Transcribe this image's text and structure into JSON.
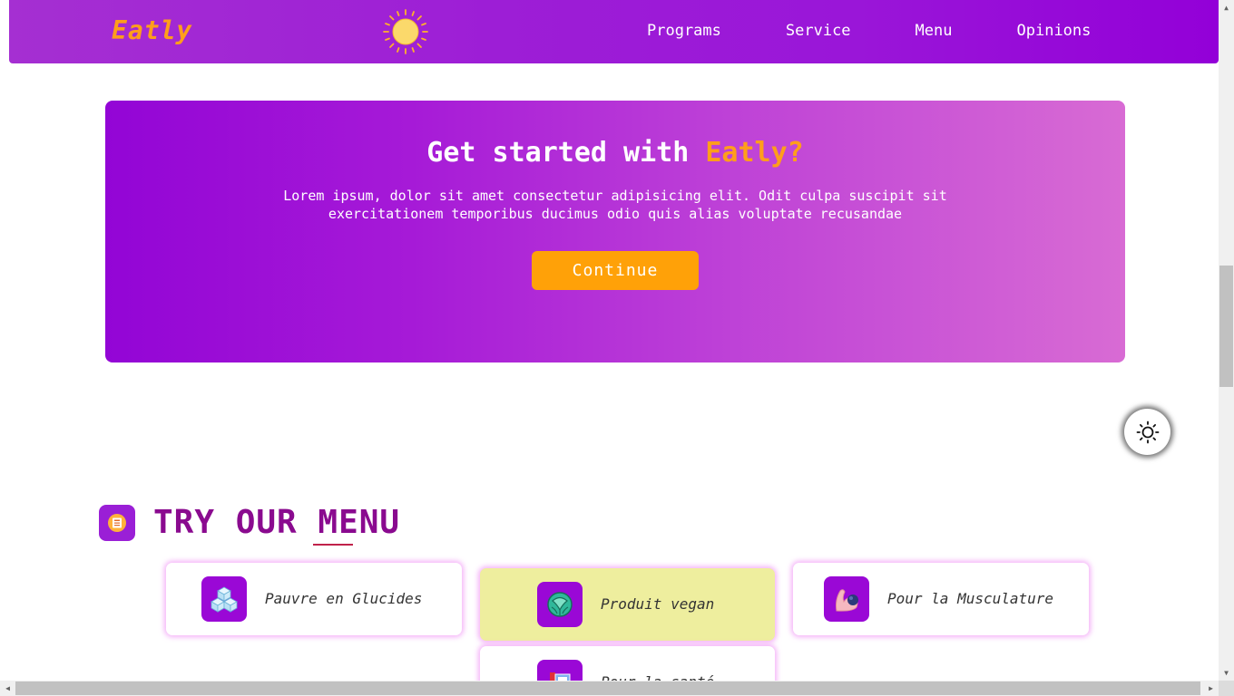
{
  "navbar": {
    "logo": "Eatly",
    "links": [
      "Programs",
      "Service",
      "Menu",
      "Opinions"
    ]
  },
  "hero": {
    "title_prefix": "Get started with ",
    "title_accent": "Eatly?",
    "description": "Lorem ipsum, dolor sit amet consectetur adipisicing elit. Odit culpa suscipit sit exercitationem temporibus ducimus odio quis alias voluptate recusandae",
    "button_label": "Continue"
  },
  "menu_section": {
    "title": "TRY OUR MENU",
    "cards": [
      {
        "label": "Pauvre en Glucides",
        "icon": "sugar-cubes-icon"
      },
      {
        "label": "Produit vegan",
        "icon": "cabbage-icon"
      },
      {
        "label": "Pour la Musculature",
        "icon": "flexed-arm-icon"
      },
      {
        "label": "Pour la santé",
        "icon": "health-book-icon"
      }
    ]
  },
  "colors": {
    "brand_purple": "#9305d6",
    "accent_orange": "#ffa108",
    "title_purple": "#8a0a8f",
    "highlight_card": "#eeee9e"
  }
}
